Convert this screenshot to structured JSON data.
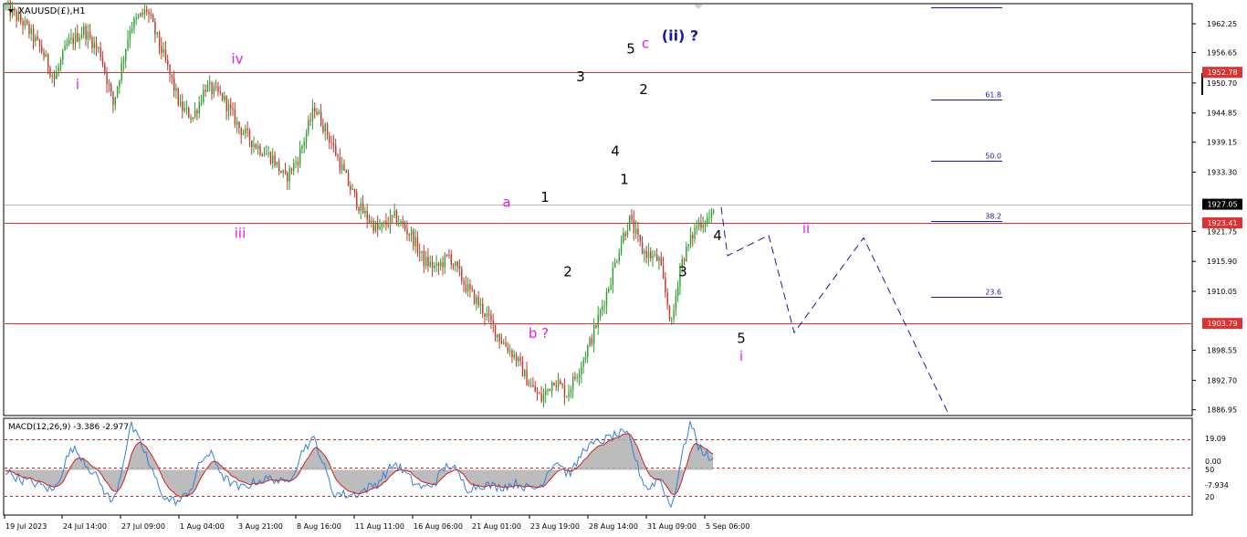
{
  "chart_title": "XAUUSD(£),H1",
  "macd_label": "MACD(12,26,9) -3.386 -2.977",
  "colors": {
    "bull": "#2ca02c",
    "bear": "#c0392b",
    "level_line": "#e03030",
    "price_line": "#b8b8b8",
    "fib_line": "#1a1aa0",
    "projection": "#1a1aa0",
    "wave_black": "#000000",
    "wave_magenta": "#e020e0",
    "wave_blue": "#1a1aa0",
    "macd_hist": "#b0b0b0",
    "macd_main": "#3080e0",
    "macd_signal": "#d02020",
    "badge_red": "#e03030",
    "badge_black": "#000000"
  },
  "chart_data": {
    "type": "candlestick",
    "price_axis": {
      "ticks": [
        "1962.25",
        "1956.65",
        "1950.70",
        "1944.85",
        "1939.15",
        "1933.30",
        "1921.75",
        "1915.90",
        "1910.05",
        "1898.55",
        "1892.70",
        "1886.95"
      ],
      "range": [
        1886.0,
        1966.0
      ]
    },
    "time_axis": {
      "labels": [
        "19 Jul 2023",
        "24 Jul 14:00",
        "27 Jul 09:00",
        "1 Aug 04:00",
        "3 Aug 21:00",
        "8 Aug 16:00",
        "11 Aug 11:00",
        "16 Aug 06:00",
        "21 Aug 01:00",
        "23 Aug 19:00",
        "28 Aug 14:00",
        "31 Aug 09:00",
        "5 Sep 06:00"
      ],
      "n_bars": 338
    },
    "price_path": [
      [
        0,
        1966.0
      ],
      [
        10,
        1962.0
      ],
      [
        18,
        1957.0
      ],
      [
        24,
        1951.5
      ],
      [
        30,
        1958.0
      ],
      [
        38,
        1961.0
      ],
      [
        46,
        1956.5
      ],
      [
        52,
        1946.5
      ],
      [
        60,
        1961.5
      ],
      [
        68,
        1965.0
      ],
      [
        76,
        1956.0
      ],
      [
        84,
        1946.0
      ],
      [
        90,
        1944.0
      ],
      [
        96,
        1950.0
      ],
      [
        104,
        1948.0
      ],
      [
        112,
        1942.0
      ],
      [
        120,
        1938.5
      ],
      [
        128,
        1936.0
      ],
      [
        134,
        1932.0
      ],
      [
        140,
        1936.0
      ],
      [
        148,
        1946.0
      ],
      [
        156,
        1939.0
      ],
      [
        164,
        1931.0
      ],
      [
        170,
        1926.0
      ],
      [
        178,
        1922.0
      ],
      [
        186,
        1924.5
      ],
      [
        194,
        1921.0
      ],
      [
        200,
        1916.0
      ],
      [
        206,
        1914.5
      ],
      [
        212,
        1917.0
      ],
      [
        220,
        1911.0
      ],
      [
        228,
        1906.5
      ],
      [
        236,
        1901.0
      ],
      [
        244,
        1897.0
      ],
      [
        250,
        1892.0
      ],
      [
        256,
        1889.0
      ],
      [
        262,
        1893.0
      ],
      [
        268,
        1890.0
      ],
      [
        274,
        1895.0
      ],
      [
        280,
        1901.0
      ],
      [
        288,
        1911.0
      ],
      [
        294,
        1920.0
      ],
      [
        298,
        1924.0
      ],
      [
        304,
        1918.0
      ],
      [
        312,
        1916.0
      ],
      [
        318,
        1903.5
      ],
      [
        322,
        1915.0
      ],
      [
        330,
        1923.0
      ],
      [
        338,
        1925.0
      ]
    ],
    "horizontal_levels": [
      {
        "price": 1952.78,
        "label": "1952.78",
        "style": "red"
      },
      {
        "price": 1923.41,
        "label": "1923.41",
        "style": "red"
      },
      {
        "price": 1903.79,
        "label": "1903.79",
        "style": "red"
      },
      {
        "price": 1927.05,
        "label": "1927.05",
        "style": "current"
      }
    ],
    "fibonacci": [
      {
        "price": 1947.5,
        "label": "61.8"
      },
      {
        "price": 1935.5,
        "label": "50.0"
      },
      {
        "price": 1923.7,
        "label": "38.2"
      },
      {
        "price": 1909.0,
        "label": "23.6"
      }
    ],
    "wave_labels": [
      {
        "text": "i",
        "color": "magenta",
        "bar": 85,
        "price": 1949.5
      },
      {
        "text": "iv",
        "color": "magenta",
        "bar": 260,
        "price": 1954.5
      },
      {
        "text": "iii",
        "color": "magenta",
        "bar": 263,
        "price": 1920.5
      },
      {
        "text": "a",
        "color": "magenta",
        "bar": 555,
        "price": 1926.5
      },
      {
        "text": "b ?",
        "color": "magenta",
        "bar": 590,
        "price": 1901.0
      },
      {
        "text": "1",
        "color": "black",
        "bar": 597,
        "price": 1927.5
      },
      {
        "text": "2",
        "color": "black",
        "bar": 622,
        "price": 1913.0
      },
      {
        "text": "3",
        "color": "black",
        "bar": 636,
        "price": 1951.0
      },
      {
        "text": "4",
        "color": "black",
        "bar": 674,
        "price": 1936.5
      },
      {
        "text": "1",
        "color": "black",
        "bar": 684,
        "price": 1931.0
      },
      {
        "text": "5",
        "color": "black",
        "bar": 691,
        "price": 1956.5
      },
      {
        "text": "c",
        "color": "magenta",
        "bar": 707,
        "price": 1957.5
      },
      {
        "text": "(ii) ?",
        "color": "blue",
        "bar": 745,
        "price": 1959.0
      },
      {
        "text": "2",
        "color": "black",
        "bar": 705,
        "price": 1948.5
      },
      {
        "text": "3",
        "color": "black",
        "bar": 748,
        "price": 1913.0
      },
      {
        "text": "4",
        "color": "black",
        "bar": 786,
        "price": 1920.0
      },
      {
        "text": "5",
        "color": "black",
        "bar": 812,
        "price": 1900.0
      },
      {
        "text": "i",
        "color": "magenta",
        "bar": 812,
        "price": 1896.5
      },
      {
        "text": "ii",
        "color": "magenta",
        "bar": 883,
        "price": 1921.5
      }
    ],
    "projection_path": [
      [
        790,
        1926.5
      ],
      [
        797,
        1917.0
      ],
      [
        842,
        1921.0
      ],
      [
        870,
        1902.0
      ],
      [
        946,
        1920.5
      ],
      [
        1038,
        1886.5
      ]
    ],
    "time_separator_bar": 1022,
    "macd": {
      "label_main": "MACD(12,26,9)",
      "value_main": -3.386,
      "value_signal": -2.977,
      "axis_ticks": [
        "19.09",
        "0.00",
        "50",
        "-7.934",
        "20"
      ]
    }
  }
}
